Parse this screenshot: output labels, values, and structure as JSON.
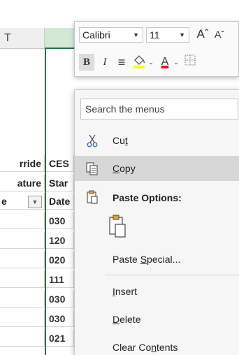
{
  "sheet": {
    "col_header_left": "T",
    "cells_a": [
      "rride",
      "ature",
      "e"
    ],
    "cells_b_header": [
      "CES",
      "Star",
      "Date"
    ],
    "cells_b_data": [
      "030",
      "120",
      "020",
      "111",
      "030",
      "030",
      "021"
    ]
  },
  "toolbar": {
    "font_name": "Calibri",
    "font_size": "11",
    "grow_font": "Aˆ",
    "shrink_font": "Aˇ",
    "bold": "B",
    "italic": "I",
    "align": "≡",
    "font_color_letter": "A",
    "highlight_color": "#ffff00",
    "font_color": "#e81123"
  },
  "menu": {
    "search_placeholder": "Search the menus",
    "cut": {
      "pre": "Cu",
      "ul": "t",
      "post": ""
    },
    "copy": {
      "pre": "",
      "ul": "C",
      "post": "opy"
    },
    "paste_options": "Paste Options:",
    "paste_special": {
      "pre": "Paste ",
      "ul": "S",
      "post": "pecial..."
    },
    "insert": {
      "pre": "",
      "ul": "I",
      "post": "nsert"
    },
    "delete": {
      "pre": "",
      "ul": "D",
      "post": "elete"
    },
    "clear_contents": {
      "pre": "Clear Co",
      "ul": "n",
      "post": "tents"
    }
  },
  "colors": {
    "selection_green": "#217346",
    "menu_bg": "#f6f6f6",
    "hover_bg": "#d7d7d7"
  }
}
